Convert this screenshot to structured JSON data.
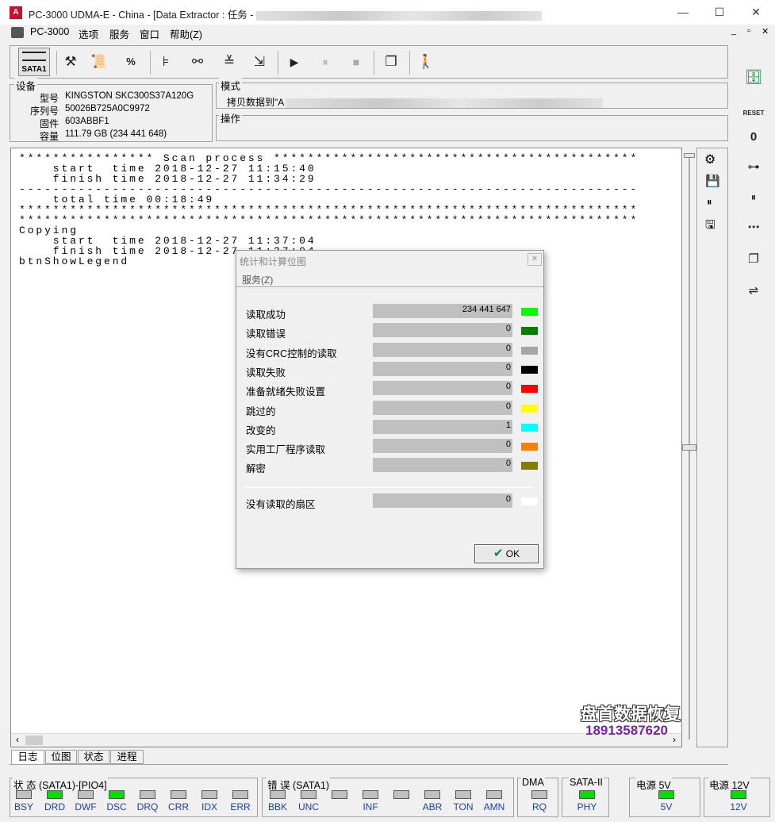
{
  "window": {
    "title": "PC-3000 UDMA-E - China - [Data Extractor : 任务 -",
    "minimize_glyph": "—",
    "maximize_glyph": "☐",
    "close_glyph": "✕",
    "app_icon_glyph": "A"
  },
  "menu": {
    "items": [
      "PC-3000",
      "选项",
      "服务",
      "窗口",
      "帮助(Z)"
    ],
    "right_controls": [
      "_",
      "▫",
      "✕"
    ]
  },
  "toolbar": {
    "sata_label": "SATA1",
    "icons": [
      "tools-icon",
      "scroll-icon",
      "percent-icon",
      "tree-icon",
      "binoculars-icon",
      "stack-icon",
      "export-icon",
      "play-icon",
      "pause-icon",
      "stop-icon",
      "copy-window-icon",
      "run-icon"
    ],
    "glyphs": [
      "⚒",
      "📜",
      "%",
      "⊧",
      "⚯",
      "≚",
      "⇲",
      "▶",
      "⏸",
      "■",
      "❐",
      "🚶"
    ]
  },
  "device": {
    "group_label": "设备",
    "fields": [
      {
        "label": "型号",
        "value": "KINGSTON SKC300S37A120G"
      },
      {
        "label": "序列号",
        "value": "50026B725A0C9972"
      },
      {
        "label": "固件",
        "value": "603ABBF1"
      },
      {
        "label": "容量",
        "value": "111.79 GB (234 441 648)"
      }
    ]
  },
  "mode": {
    "group_label": "模式",
    "value_prefix": "拷贝数据到\"A"
  },
  "operation": {
    "group_label": "操作"
  },
  "log": {
    "lines": [
      "**************** Scan process *******************************************",
      "    start  time 2018-12-27 11:15:40",
      "    finish time 2018-12-27 11:34:29",
      "-------------------------------------------------------------------------",
      "    total time 00:18:49",
      "*************************************************************************",
      "*************************************************************************",
      "Copying",
      "    start  time 2018-12-27 11:37:04",
      "    finish time 2018-12-27 11:37:04",
      "btnShowLegend"
    ]
  },
  "tabs": [
    "日志",
    "位图",
    "状态",
    "进程"
  ],
  "status": {
    "state_label": "状 态 (SATA1)-[PIO4]",
    "state_leds": [
      {
        "name": "BSY",
        "on": false
      },
      {
        "name": "DRD",
        "on": true
      },
      {
        "name": "DWF",
        "on": false
      },
      {
        "name": "DSC",
        "on": true
      },
      {
        "name": "DRQ",
        "on": false
      },
      {
        "name": "CRR",
        "on": false
      },
      {
        "name": "IDX",
        "on": false
      },
      {
        "name": "ERR",
        "on": false
      }
    ],
    "error_label": "错 误 (SATA1)",
    "error_leds": [
      {
        "name": "BBK",
        "on": false
      },
      {
        "name": "UNC",
        "on": false
      },
      {
        "name": "",
        "on": false
      },
      {
        "name": "INF",
        "on": false
      },
      {
        "name": "",
        "on": false
      },
      {
        "name": "ABR",
        "on": false
      },
      {
        "name": "TON",
        "on": false
      },
      {
        "name": "AMN",
        "on": false
      }
    ],
    "dma_label": "DMA",
    "dma_led": {
      "name": "RQ",
      "on": false
    },
    "sata_label": "SATA-II",
    "sata_led": {
      "name": "PHY",
      "on": true
    },
    "p5_label": "电源 5V",
    "p5_led": {
      "name": "5V",
      "on": true
    },
    "p12_label": "电源 12V",
    "p12_led": {
      "name": "12V",
      "on": true
    }
  },
  "dialog": {
    "title": "统计和计算位图",
    "menu": "服务(Z)",
    "close_glyph": "✕",
    "rows": [
      {
        "label": "读取成功",
        "value": "234 441 647",
        "color": "#00ff00"
      },
      {
        "label": "读取错误",
        "value": "0",
        "color": "#008000"
      },
      {
        "label": "没有CRC控制的读取",
        "value": "0",
        "color": "#a6a6a6"
      },
      {
        "label": "读取失败",
        "value": "0",
        "color": "#000000"
      },
      {
        "label": "准备就绪失败设置",
        "value": "0",
        "color": "#ff0000"
      },
      {
        "label": "跳过的",
        "value": "0",
        "color": "#ffff00"
      },
      {
        "label": "改变的",
        "value": "1",
        "color": "#00ffff"
      },
      {
        "label": "实用工厂程序读取",
        "value": "0",
        "color": "#ff8000"
      },
      {
        "label": "解密",
        "value": "0",
        "color": "#808000"
      }
    ],
    "unread": {
      "label": "没有读取的扇区",
      "value": "0",
      "color": "#ffffff"
    },
    "ok_label": "OK",
    "ok_glyph": "✔"
  },
  "right_tools": {
    "glyphs": [
      "⚙",
      "💾",
      "⏸",
      "🖫"
    ]
  },
  "right_bar": {
    "glyphs": [
      "🗄",
      "RESET",
      "0",
      "⊶",
      "⏸",
      "⋯",
      "❐",
      "⇌"
    ]
  },
  "watermark": {
    "line1": "盘首数据恢复",
    "line2": "18913587620"
  }
}
